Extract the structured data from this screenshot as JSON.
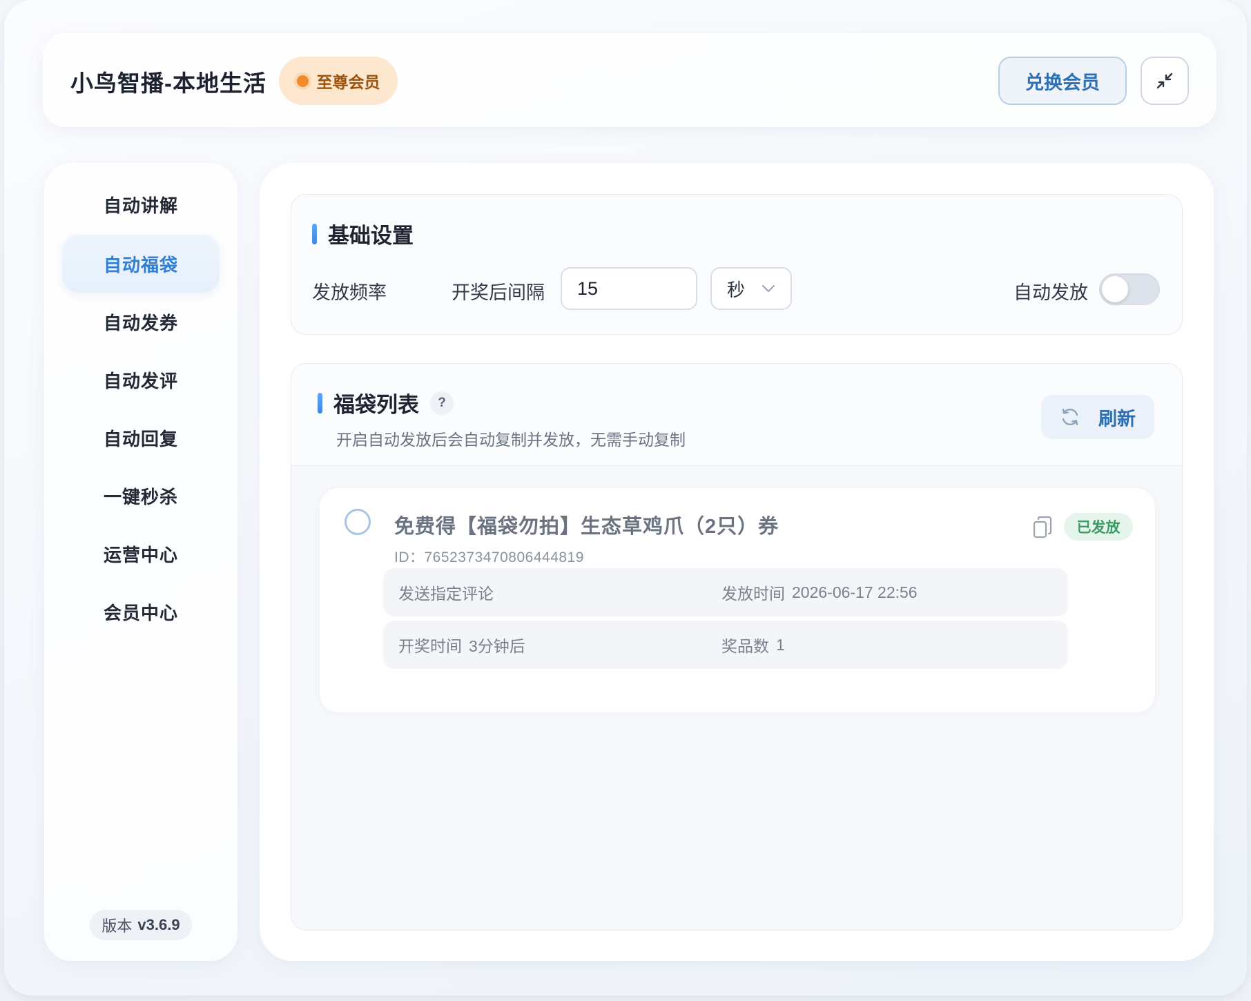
{
  "header": {
    "app_title": "小鸟智播-本地生活",
    "vip_label": "至尊会员",
    "redeem_label": "兑换会员",
    "collapse_icon": "collapse-arrows-icon"
  },
  "sidebar": {
    "items": [
      {
        "label": "自动讲解",
        "active": false
      },
      {
        "label": "自动福袋",
        "active": true
      },
      {
        "label": "自动发券",
        "active": false
      },
      {
        "label": "自动发评",
        "active": false
      },
      {
        "label": "自动回复",
        "active": false
      },
      {
        "label": "一键秒杀",
        "active": false
      },
      {
        "label": "运营中心",
        "active": false
      },
      {
        "label": "会员中心",
        "active": false
      }
    ],
    "version_prefix": "版本",
    "version_number": "v3.6.9"
  },
  "basic_settings": {
    "title": "基础设置",
    "frequency_label": "发放频率",
    "interval_label": "开奖后间隔",
    "interval_value": "15",
    "unit_value": "秒",
    "auto_issue_label": "自动发放",
    "auto_issue_on": false
  },
  "lucky_list": {
    "title": "福袋列表",
    "help_glyph": "?",
    "subtitle": "开启自动发放后会自动复制并发放，无需手动复制",
    "refresh_label": "刷新",
    "items": [
      {
        "title": "免费得【福袋勿拍】生态草鸡爪（2只）券",
        "id_text": "ID：7652373470806444819",
        "status": "已发放",
        "comment_label": "发送指定评论",
        "issue_time_label": "发放时间",
        "issue_time_value": "2026-06-17 22:56",
        "draw_time_label": "开奖时间",
        "draw_time_value": "3分钟后",
        "prize_count_label": "奖品数",
        "prize_count_value": "1"
      }
    ]
  },
  "colors": {
    "accent": "#2f7fd6",
    "vip_bg": "#fde7cf",
    "vip_dot": "#f08a2b",
    "status_green": "#3c9a63"
  }
}
